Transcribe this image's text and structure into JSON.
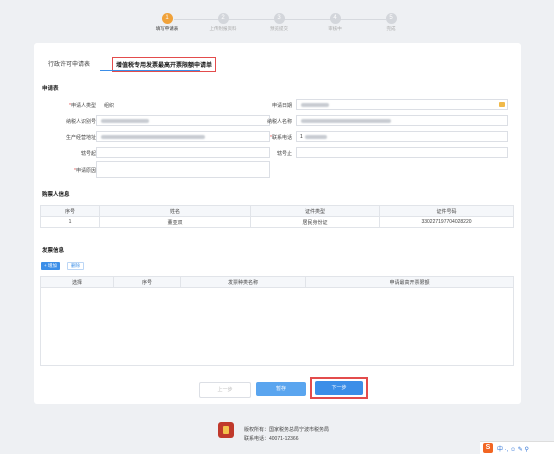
{
  "steps": [
    {
      "num": "1",
      "label": "填写申请表"
    },
    {
      "num": "2",
      "label": "上传附报资料"
    },
    {
      "num": "3",
      "label": "预览提交"
    },
    {
      "num": "4",
      "label": "审核中"
    },
    {
      "num": "5",
      "label": "完成"
    }
  ],
  "tabs": {
    "tab1": "行政许可申请表",
    "tab2": "增值税专用发票最高开票限额申请单"
  },
  "application": {
    "section_title": "申请表",
    "applicant_type_label": "申请人类型",
    "applicant_type_value": "组织",
    "apply_date_label": "申请日期",
    "taxpayer_id_label": "纳税人识别号",
    "taxpayer_name_label": "纳税人名称",
    "address_label": "生产经营地址",
    "phone_label": "联系电话",
    "phone_value": "1",
    "auth_from_label": "辖号起",
    "auth_to_label": "辖号止",
    "reason_label": "申请原因"
  },
  "buyer": {
    "section_title": "购票人信息",
    "headers": [
      "序号",
      "姓名",
      "证件类型",
      "证件号码"
    ],
    "rows": [
      [
        "1",
        "董亚双",
        "居民身份证",
        "330227197704028220"
      ]
    ]
  },
  "invoice": {
    "section_title": "发票信息",
    "add_label": "+ 增加",
    "delete_label": "删除",
    "headers": [
      "选择",
      "序号",
      "发票种类名称",
      "申请最高开票限额"
    ]
  },
  "buttons": {
    "prev": "上一步",
    "save": "暂存",
    "next": "下一步"
  },
  "footer": {
    "line1": "版权所有：国家税务总局宁波市税务局",
    "line2": "联系电话：40071-12366"
  },
  "ime": {
    "logo": "S",
    "rest": "中 ·, ☺ ✎ ⚲"
  },
  "colors": {
    "accent": "#3b8ee8",
    "step_active": "#f0a23a",
    "highlight": "#e34c4c"
  }
}
